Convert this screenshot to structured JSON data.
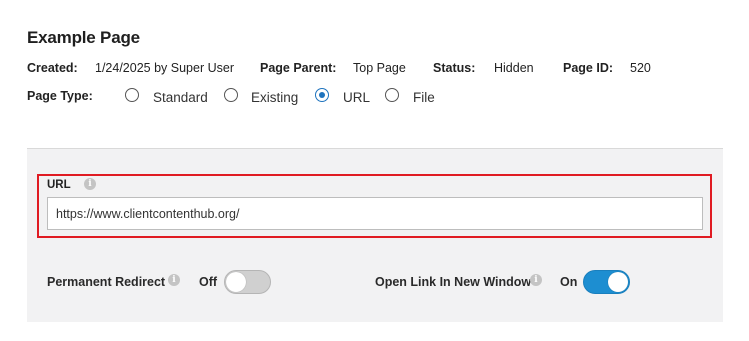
{
  "page": {
    "title": "Example Page"
  },
  "meta": {
    "created_label": "Created:",
    "created_value": "1/24/2025 by Super User",
    "parent_label": "Page Parent:",
    "parent_value": "Top Page",
    "status_label": "Status:",
    "status_value": "Hidden",
    "id_label": "Page ID:",
    "id_value": "520"
  },
  "page_type": {
    "label": "Page Type:",
    "options": [
      "Standard",
      "Existing",
      "URL",
      "File"
    ],
    "selected": "URL"
  },
  "url_section": {
    "label": "URL",
    "value": "https://www.clientcontenthub.org/"
  },
  "permanent_redirect": {
    "label": "Permanent Redirect",
    "state": "Off",
    "enabled": false
  },
  "open_new_window": {
    "label": "Open Link In New Window",
    "state": "On",
    "enabled": true
  },
  "colors": {
    "accent": "#1e73be",
    "toggle_on": "#1d8ed1",
    "highlight_border": "#e01b22",
    "panel_bg": "#f2f2f3"
  },
  "icons": {
    "info": "info-icon"
  }
}
